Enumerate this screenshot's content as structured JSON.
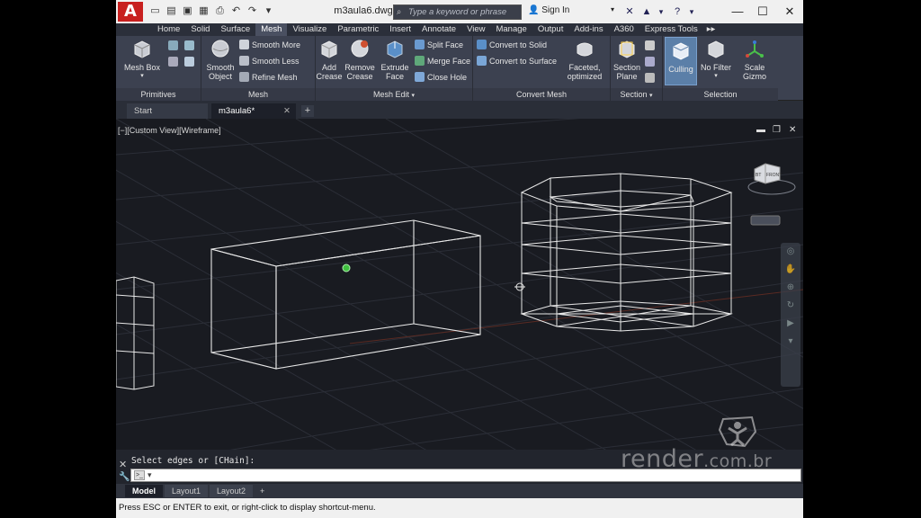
{
  "titlebar": {
    "app_logo": "A",
    "file_name": "m3aula6.dwg",
    "search_placeholder": "Type a keyword or phrase",
    "signin_label": "Sign In",
    "icons": [
      "new-icon",
      "open-icon",
      "save-icon",
      "saveas-icon",
      "print-icon",
      "undo-icon",
      "redo-icon",
      "search-icon",
      "user-icon",
      "exchange-icon",
      "a360-icon",
      "help-icon"
    ]
  },
  "ribbon": {
    "tabs": [
      "Home",
      "Solid",
      "Surface",
      "Mesh",
      "Visualize",
      "Parametric",
      "Insert",
      "Annotate",
      "View",
      "Manage",
      "Output",
      "Add-ins",
      "A360",
      "Express Tools"
    ],
    "active_tab": "Mesh",
    "tab_overflow": "▸▸",
    "panels": {
      "primitives": {
        "label": "Primitives",
        "mesh_box": "Mesh Box"
      },
      "mesh": {
        "label": "Mesh",
        "smooth_object": "Smooth Object",
        "smooth_more": "Smooth More",
        "smooth_less": "Smooth Less",
        "refine_mesh": "Refine Mesh"
      },
      "mesh_edit": {
        "label": "Mesh Edit",
        "add_crease": "Add Crease",
        "remove_crease": "Remove Crease",
        "extrude_face": "Extrude Face",
        "split_face": "Split Face",
        "merge_face": "Merge Face",
        "close_hole": "Close Hole"
      },
      "convert_mesh": {
        "label": "Convert Mesh",
        "faceted_optimized": "Faceted, optimized",
        "convert_to_solid": "Convert to Solid",
        "convert_to_surface": "Convert to Surface"
      },
      "section": {
        "label": "Section",
        "section_plane": "Section Plane"
      },
      "selection": {
        "label": "Selection",
        "culling": "Culling",
        "no_filter": "No Filter",
        "scale_gizmo": "Scale Gizmo"
      }
    }
  },
  "doc_tabs": {
    "start": "Start",
    "file": "m3aula6*",
    "add": "+"
  },
  "viewport": {
    "label": "[−][Custom View][Wireframe]",
    "viewcube_labels": [
      "BT",
      "FRONT"
    ]
  },
  "command_line": {
    "history": "Select edges or [CHain]:",
    "prompt_icon": ">_"
  },
  "layout_tabs": [
    "Model",
    "Layout1",
    "Layout2"
  ],
  "layout_add": "+",
  "status": "Press ESC or ENTER to exit, or right-click to display shortcut-menu.",
  "watermark": {
    "main": "render",
    "suffix": ".com.br"
  },
  "colors": {
    "viewport_bg": "#191b21",
    "ribbon_bg": "#3c4150",
    "accent": "#5b7fa8",
    "logo_red": "#c8201f"
  }
}
